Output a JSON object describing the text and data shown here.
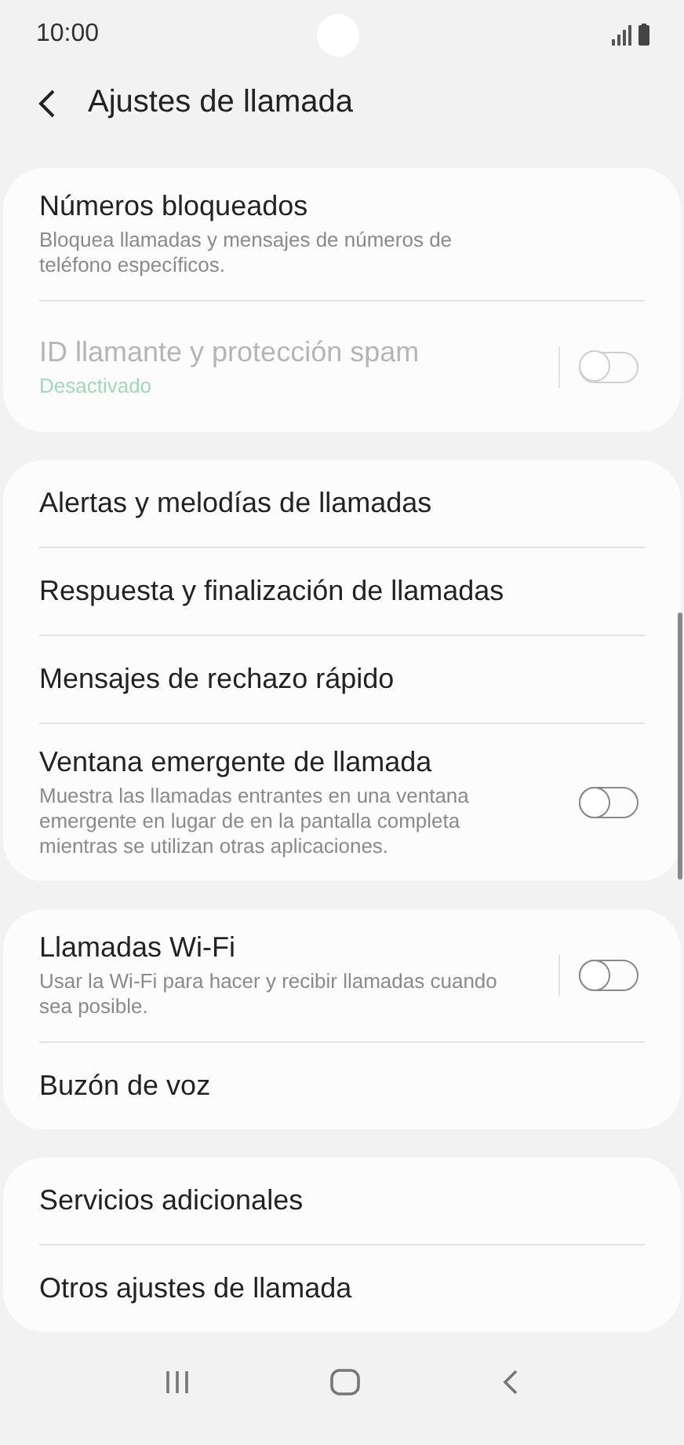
{
  "status_bar": {
    "time": "10:00"
  },
  "header": {
    "title": "Ajustes de llamada"
  },
  "groups": [
    {
      "items": [
        {
          "kind": "plain",
          "title": "Números bloqueados",
          "subtitle": "Bloquea llamadas y mensajes de números de teléfono específicos.",
          "disabled": false
        },
        {
          "kind": "switch",
          "title": "ID llamante y protección spam",
          "status": "Desactivado",
          "disabled": true,
          "on": false,
          "split": true
        }
      ]
    },
    {
      "items": [
        {
          "kind": "plain",
          "title": "Alertas y melodías de llamadas",
          "disabled": false
        },
        {
          "kind": "plain",
          "title": "Respuesta y finalización de llamadas",
          "disabled": false
        },
        {
          "kind": "plain",
          "title": "Mensajes de rechazo rápido",
          "disabled": false
        },
        {
          "kind": "switch",
          "title": "Ventana emergente de llamada",
          "subtitle": "Muestra las llamadas entrantes en una ventana emergente en lugar de en la pantalla completa mientras se utilizan otras aplicaciones.",
          "disabled": false,
          "on": false,
          "split": false
        }
      ]
    },
    {
      "items": [
        {
          "kind": "switch",
          "title": "Llamadas Wi-Fi",
          "subtitle": "Usar la Wi-Fi para hacer y recibir llamadas cuando sea posible.",
          "disabled": false,
          "on": false,
          "split": true
        },
        {
          "kind": "plain",
          "title": "Buzón de voz",
          "disabled": false
        }
      ]
    },
    {
      "items": [
        {
          "kind": "plain",
          "title": "Servicios adicionales",
          "disabled": false
        },
        {
          "kind": "plain",
          "title": "Otros ajustes de llamada",
          "disabled": false
        }
      ]
    }
  ]
}
